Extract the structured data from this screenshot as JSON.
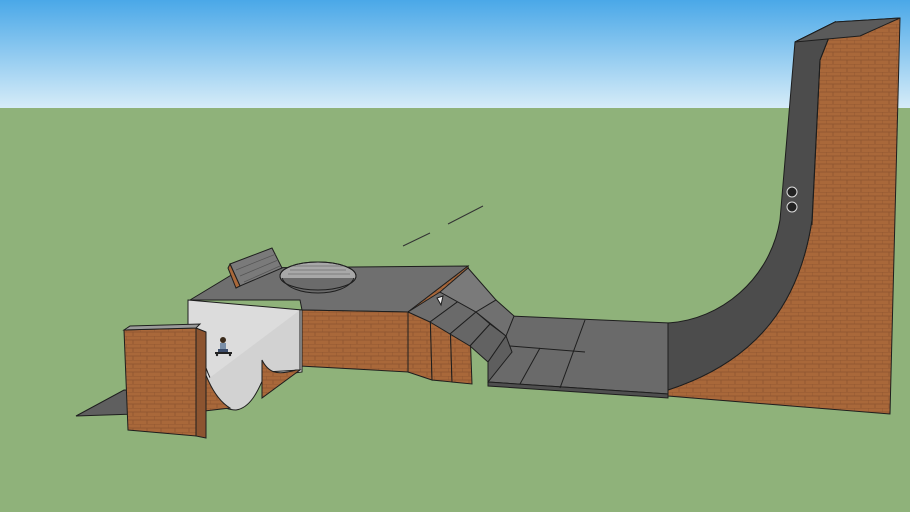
{
  "scene": {
    "colors": {
      "sky_top": "#4aa8e8",
      "sky_bottom": "#d6ecf8",
      "ground": "#8fb27a",
      "brick": "#a9683a",
      "concrete_top": "#6f6f6f",
      "concrete_dark": "#4f4f4f",
      "concrete_light": "#8a8a8a",
      "ramp_white": "#dcdcdc",
      "edge": "#1e1e1e"
    },
    "objects": {
      "vert_ramp": "vert-ramp-brick",
      "stairs": "stair-set",
      "funbox": "funbox-platform",
      "bowl": "bowl",
      "quarter_pipe": "small-quarter-pipe",
      "halfpipe": "white-halfpipe",
      "left_wall": "brick-wall-left",
      "skater": "skater-figure",
      "wheels": "wheel-icons"
    }
  }
}
